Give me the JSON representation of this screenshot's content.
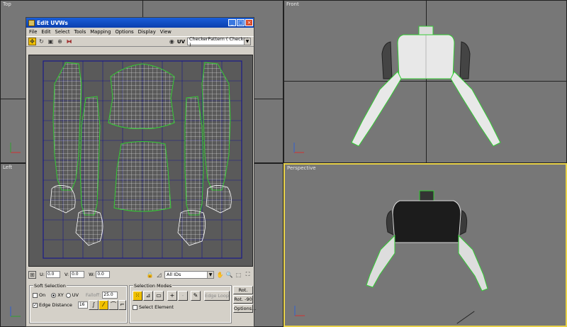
{
  "viewports": {
    "top": "Top",
    "front": "Front",
    "left": "Left",
    "perspective": "Perspective"
  },
  "window": {
    "title": "Edit UVWs",
    "minimize": "_",
    "maximize": "□",
    "close": "×",
    "menu": [
      "File",
      "Edit",
      "Select",
      "Tools",
      "Mapping",
      "Options",
      "Display",
      "View"
    ],
    "uv_label": "UV",
    "texture_dropdown": "CheckerPattern  ( Checker )",
    "u_label": "U:",
    "u_value": "0.0",
    "v_label": "V:",
    "v_value": "0.0",
    "w_label": "W:",
    "w_value": "0.0",
    "ids_dropdown": "All IDs"
  },
  "soft_selection": {
    "title": "Soft Selection",
    "on_label": "On",
    "xy_label": "XY",
    "uv_label": "UV",
    "falloff_label": "Falloff:",
    "falloff_value": "25.0",
    "edge_distance_label": "Edge Distance",
    "edge_distance_value": "16"
  },
  "selection_modes": {
    "title": "Selection Modes",
    "plus": "+",
    "minus": "-",
    "edge_loop": "Edge Loop",
    "select_element": "Select Element"
  },
  "rotate": {
    "rot_plus": "Rot. +90",
    "rot_minus": "Rot. -90",
    "options": "Options..."
  },
  "colors": {
    "mesh": "#ffffff",
    "seam": "#33cc33",
    "grid": "#1a1a8a",
    "active_border": "#e8d24a"
  }
}
